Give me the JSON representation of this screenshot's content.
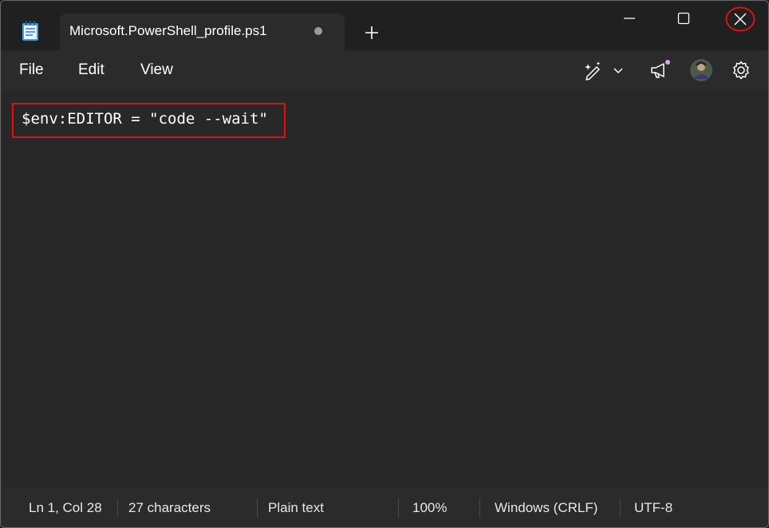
{
  "window": {
    "tab_title": "Microsoft.PowerShell_profile.ps1",
    "tab_state": "unsaved"
  },
  "menu": {
    "file": "File",
    "edit": "Edit",
    "view": "View"
  },
  "toolbar": {
    "icons": [
      "copilot-pen-icon",
      "chevron-down-icon",
      "megaphone-icon",
      "avatar",
      "gear-icon"
    ]
  },
  "editor": {
    "line_1": "$env:EDITOR = \"code --wait\""
  },
  "status": {
    "position": "Ln 1, Col 28",
    "characters": "27 characters",
    "format": "Plain text",
    "zoom": "100%",
    "line_ending": "Windows (CRLF)",
    "encoding": "UTF-8"
  },
  "colors": {
    "titlebar_bg": "#202020",
    "menubar_bg": "#2b2b2b",
    "editor_bg": "#282828",
    "annotation": "#e01010",
    "notification_dot": "#d8a8e8"
  }
}
